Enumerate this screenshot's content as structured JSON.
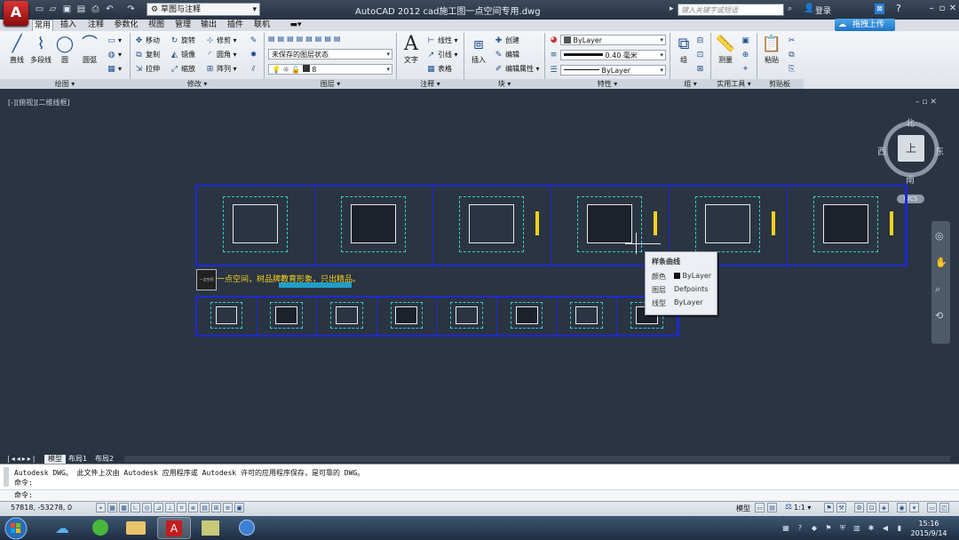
{
  "window": {
    "title": "AutoCAD 2012    cad施工图一点空间专用.dwg",
    "workspace": "草图与注释",
    "search_placeholder": "键入关键字或短语",
    "login": "登录",
    "upload_button": "拖拽上传"
  },
  "menu_tabs": [
    "常用",
    "插入",
    "注释",
    "参数化",
    "视图",
    "管理",
    "输出",
    "插件",
    "联机"
  ],
  "ribbon": {
    "draw": {
      "big_buttons": [
        "直线",
        "多段线",
        "圆",
        "圆弧"
      ],
      "panel_label": "绘图"
    },
    "modify": {
      "items": [
        "移动",
        "旋转",
        "修剪",
        "复制",
        "镜像",
        "圆角",
        "拉伸",
        "缩放",
        "阵列"
      ],
      "panel_label": "修改"
    },
    "layers": {
      "layer_state": "未保存的图层状态",
      "current_layer": "8",
      "panel_label": "图层"
    },
    "annotation": {
      "big_button": "文字",
      "items": [
        "线性",
        "引线",
        "表格"
      ],
      "panel_label": "注释"
    },
    "block": {
      "big_button": "插入",
      "items": [
        "创建",
        "编辑",
        "编辑属性"
      ],
      "panel_label": "块"
    },
    "properties": {
      "color": "ByLayer",
      "lineweight": "0.40 毫米",
      "linetype": "ByLayer",
      "panel_label": "特性"
    },
    "groups": {
      "big_button": "组",
      "panel_label": "组"
    },
    "utilities": {
      "big_button": "测量",
      "panel_label": "实用工具"
    },
    "clipboard": {
      "big_button": "粘贴",
      "panel_label": "剪贴板"
    }
  },
  "viewport": {
    "label": "[-][俯视][二维线框]",
    "viewcube": {
      "north": "北",
      "south": "南",
      "west": "西",
      "east": "东",
      "top": "上"
    },
    "wcs": "WCS"
  },
  "drawing": {
    "slogan": "一点空间，树品牌教育形象，只出精品。",
    "logo_text": "一点空间",
    "top_strip_count": 6,
    "bottom_strip_count": 8
  },
  "tooltip": {
    "title": "样条曲线",
    "rows": [
      {
        "label": "颜色",
        "value": "ByLayer"
      },
      {
        "label": "图层",
        "value": "Defpoints"
      },
      {
        "label": "线型",
        "value": "ByLayer"
      }
    ]
  },
  "layout_tabs": [
    "模型",
    "布局1",
    "布局2"
  ],
  "command": {
    "history": [
      "Autodesk DWG。  此文件上次由 Autodesk 应用程序或 Autodesk 许可的应用程序保存，是可靠的 DWG。",
      "命令:"
    ],
    "prompt": "命令:"
  },
  "status": {
    "coordinates": "57818, -53278, 0",
    "model": "模型",
    "scale": "1:1"
  },
  "clock": {
    "time": "15:16",
    "date": "2015/9/14"
  },
  "colors": {
    "canvas": "#2b3442",
    "frame_blue": "#1d28d6",
    "slogan_yellow": "#f6d21d",
    "accent_cyan": "#1f9ec9"
  }
}
